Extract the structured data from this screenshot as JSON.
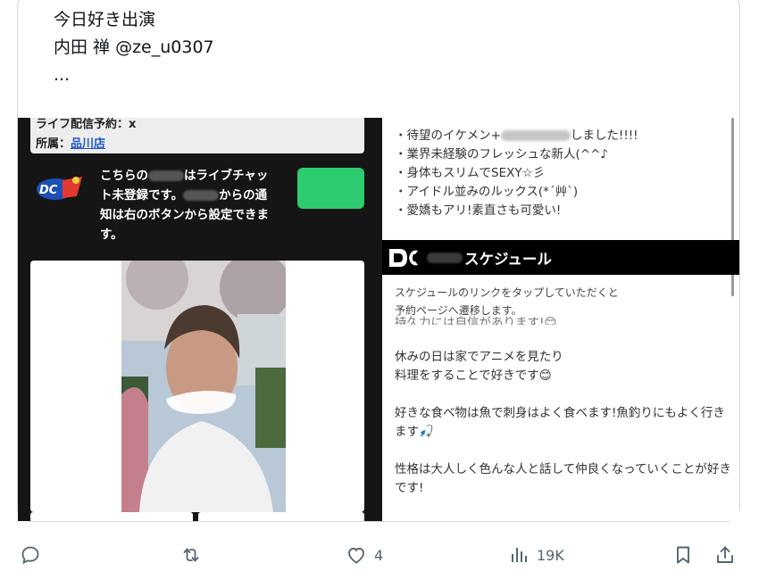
{
  "tweet": {
    "line1": "今日好き出演",
    "line2": "内田 禅 @ze_u0307",
    "line3": "..."
  },
  "embed": {
    "info_line1": "ライフ配信予約：x",
    "info_line2_prefix": "所属：",
    "info_store": "品川店",
    "notice_lines": [
      "こちらの",
      "はライブチャッ",
      "ト未登録です。",
      "からの通",
      "知は右のボタンから設定できま",
      "す。"
    ],
    "bullets": [
      "・待望のイケメン+",
      "しました!!!!",
      "・業界未経験のフレッシュな新人(^^♪",
      "・身体もスリムでSEXY☆彡",
      "・アイドル並みのルックス(*´艸`)",
      "・愛嬌もアリ!素直さも可愛い!"
    ],
    "schedule_title": "スケジュール",
    "schedule_desc_1": "スケジュールのリンクをタップしていただくと",
    "schedule_desc_2": "予約ページへ遷移します。",
    "profile_cut": "持久力には自信があります!😊",
    "profile_p1_a": "休みの日は家でアニメを見たり",
    "profile_p1_b": "料理をすることで好きです😊",
    "profile_p2": "好きな食べ物は魚で刺身はよく食べます!魚釣りにもよく行きます🎣",
    "profile_p3": "性格は大人しく色んな人と話して仲良くなっていくことが好きです!"
  },
  "actions": {
    "reply_icon": "reply-icon",
    "retweet_icon": "retweet-icon",
    "like_icon": "heart-icon",
    "like_count": "4",
    "views_icon": "views-icon",
    "views_count": "19K",
    "bookmark_icon": "bookmark-icon",
    "share_icon": "share-icon"
  },
  "colors": {
    "text": "#0f1419",
    "muted": "#536471",
    "border": "#cfd9de",
    "green": "#2ecc71",
    "link": "#1a57c8"
  }
}
